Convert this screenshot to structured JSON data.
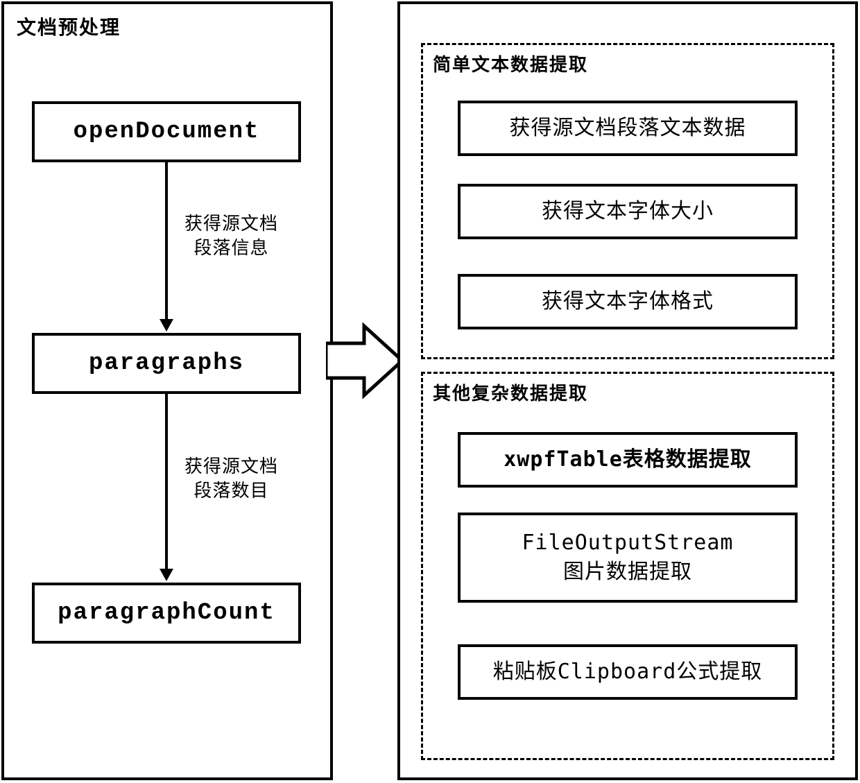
{
  "left_panel": {
    "title": "文档预处理",
    "nodes": {
      "open_document": "openDocument",
      "paragraphs": "paragraphs",
      "paragraph_count": "paragraphCount"
    },
    "edges": {
      "to_paragraphs": "获得源文档\n段落信息",
      "to_paragraph_count": "获得源文档\n段落数目"
    }
  },
  "right_panel": {
    "simple": {
      "title": "简单文本数据提取",
      "items": [
        "获得源文档段落文本数据",
        "获得文本字体大小",
        "获得文本字体格式"
      ]
    },
    "complex": {
      "title": "其他复杂数据提取",
      "items": [
        "xwpfTable表格数据提取",
        "FileOutputStream\n图片数据提取",
        "粘贴板Clipboard公式提取"
      ]
    }
  }
}
